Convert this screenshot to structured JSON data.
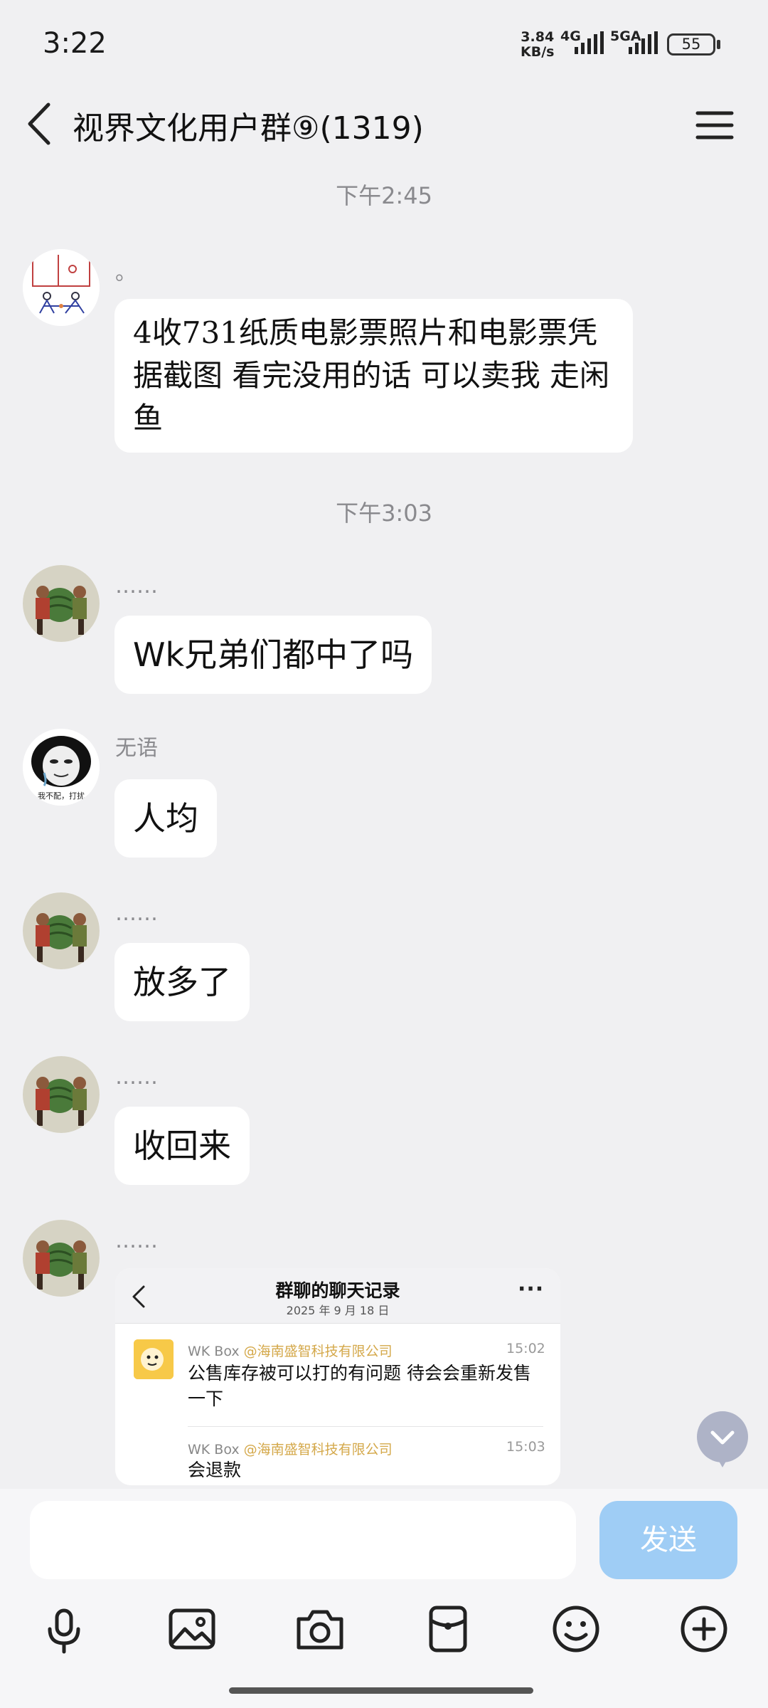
{
  "status_bar": {
    "time": "3:22",
    "speed_value": "3.84",
    "speed_unit": "KB/s",
    "net1": "4G",
    "net2": "5GA",
    "battery": "55"
  },
  "header": {
    "title": "视界文化用户群⑨(1319)",
    "back_icon": "chevron-left-icon",
    "menu_icon": "hamburger-menu-icon"
  },
  "messages": [
    {
      "type": "timestamp",
      "text": "下午2:45"
    },
    {
      "type": "message",
      "sender": "。",
      "text": "4收731纸质电影票照片和电影票凭据截图 看完没用的话 可以卖我 走闲鱼"
    },
    {
      "type": "timestamp",
      "text": "下午3:03"
    },
    {
      "type": "message",
      "sender": "……",
      "text": "Wk兄弟们都中了吗"
    },
    {
      "type": "message",
      "sender": "无语",
      "text": "人均",
      "avatar_caption": "我不配，打扰"
    },
    {
      "type": "message",
      "sender": "……",
      "text": "放多了"
    },
    {
      "type": "message",
      "sender": "……",
      "text": "收回来"
    },
    {
      "type": "forward",
      "sender": "……"
    }
  ],
  "forward_card": {
    "title": "群聊的聊天记录",
    "date": "2025 年 9 月 18 日",
    "more": "···",
    "entries": [
      {
        "name": "WK Box",
        "org": "@海南盛智科技有限公司",
        "time": "15:02",
        "text": "公售库存被可以打的有问题 待会会重新发售一下"
      },
      {
        "name": "WK Box",
        "org": "@海南盛智科技有限公司",
        "time": "15:03",
        "text": "会退款"
      }
    ]
  },
  "input": {
    "value": "",
    "placeholder": "",
    "send_label": "发送"
  },
  "toolbar": [
    "microphone-icon",
    "image-icon",
    "camera-icon",
    "red-packet-icon",
    "emoji-icon",
    "plus-icon"
  ],
  "colors": {
    "background": "#f0f0f2",
    "send_button": "#9fcdf5",
    "timestamp_text": "#8a8a8e",
    "org_text": "#d4a84a"
  }
}
